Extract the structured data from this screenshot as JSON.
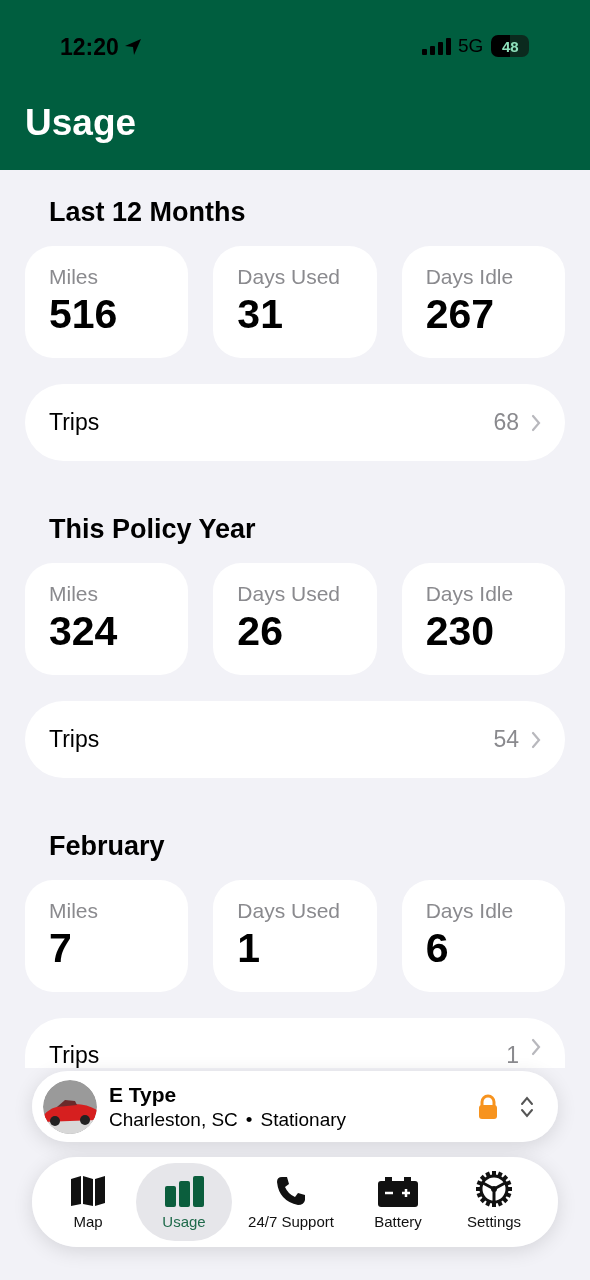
{
  "status_bar": {
    "time": "12:20",
    "network": "5G",
    "battery": "48"
  },
  "header": {
    "title": "Usage"
  },
  "sections": [
    {
      "title": "Last 12 Months",
      "stats": [
        {
          "label": "Miles",
          "value": "516"
        },
        {
          "label": "Days Used",
          "value": "31"
        },
        {
          "label": "Days Idle",
          "value": "267"
        }
      ],
      "trips": {
        "label": "Trips",
        "count": "68"
      }
    },
    {
      "title": "This Policy Year",
      "stats": [
        {
          "label": "Miles",
          "value": "324"
        },
        {
          "label": "Days Used",
          "value": "26"
        },
        {
          "label": "Days Idle",
          "value": "230"
        }
      ],
      "trips": {
        "label": "Trips",
        "count": "54"
      }
    },
    {
      "title": "February",
      "stats": [
        {
          "label": "Miles",
          "value": "7"
        },
        {
          "label": "Days Used",
          "value": "1"
        },
        {
          "label": "Days Idle",
          "value": "6"
        }
      ],
      "trips": {
        "label": "Trips",
        "count": "1"
      }
    }
  ],
  "vehicle": {
    "name": "E Type",
    "location": "Charleston, SC",
    "separator": "•",
    "state": "Stationary",
    "locked": true
  },
  "tab_bar": [
    {
      "kind": "map",
      "label": "Map",
      "selected": false
    },
    {
      "kind": "usage",
      "label": "Usage",
      "selected": true
    },
    {
      "kind": "support",
      "label": "24/7 Support",
      "selected": false
    },
    {
      "kind": "battery",
      "label": "Battery",
      "selected": false
    },
    {
      "kind": "settings",
      "label": "Settings",
      "selected": false
    }
  ]
}
